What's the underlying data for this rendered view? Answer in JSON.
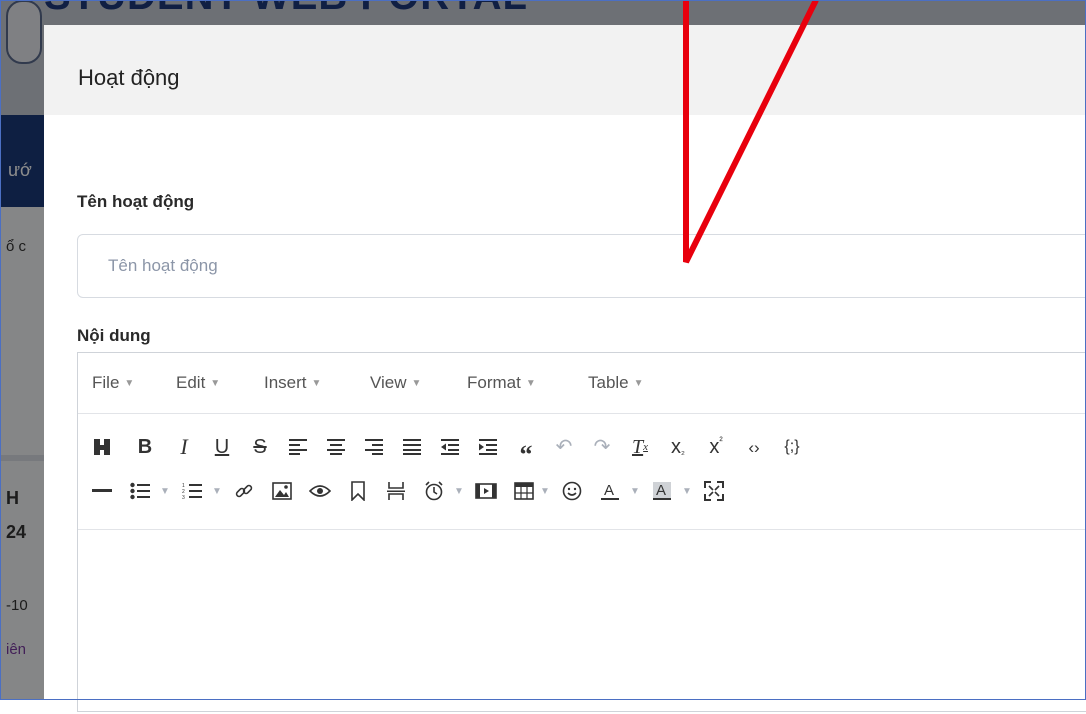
{
  "background": {
    "portal_title": "STUDENT WEB PORTAL",
    "nav_fragment": "ướ",
    "text_fragment_1": "ổ c",
    "text_fragment_2": "H",
    "text_fragment_3": "24",
    "text_fragment_4": "-10",
    "text_fragment_5": "iên"
  },
  "modal": {
    "title": "Hoạt động",
    "name_label": "Tên hoạt động",
    "name_placeholder": "Tên hoạt động",
    "name_value": "",
    "content_label": "Nội dung"
  },
  "editor": {
    "menu": [
      {
        "label": "File"
      },
      {
        "label": "Edit"
      },
      {
        "label": "Insert"
      },
      {
        "label": "View"
      },
      {
        "label": "Format"
      },
      {
        "label": "Table"
      }
    ],
    "toolbar_row1": [
      "find-replace-icon",
      "bold-icon",
      "italic-icon",
      "underline-icon",
      "strikethrough-icon",
      "align-left-icon",
      "align-center-icon",
      "align-right-icon",
      "align-justify-icon",
      "outdent-icon",
      "indent-icon",
      "blockquote-icon",
      "undo-icon",
      "redo-icon",
      "clear-format-icon",
      "subscript-icon",
      "superscript-icon",
      "code-icon",
      "code-sample-icon"
    ],
    "toolbar_row2": [
      "horizontal-rule-icon",
      "bullet-list-icon",
      "numbered-list-icon",
      "link-icon",
      "image-icon",
      "preview-icon",
      "bookmark-icon",
      "page-break-icon",
      "insert-datetime-icon",
      "media-icon",
      "table-icon",
      "emoticon-icon",
      "text-color-icon",
      "background-color-icon",
      "fullscreen-icon"
    ],
    "content": ""
  },
  "colors": {
    "arrow": "#e8000d",
    "nav_blue": "#1b3a78",
    "title_blue": "#1e3a7b"
  }
}
